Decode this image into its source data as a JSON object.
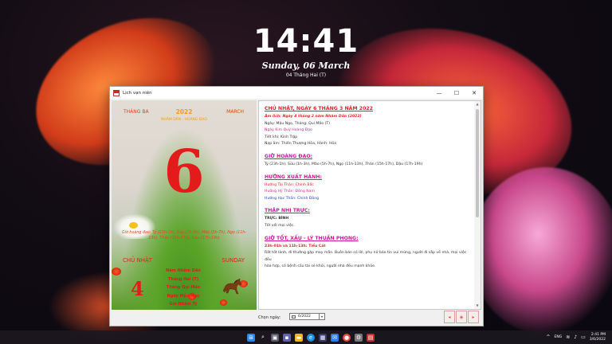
{
  "lockscreen": {
    "time": "14:41",
    "date": "Sunday, 06 March",
    "lunar": "04 Tháng Hai (T)"
  },
  "window": {
    "title": "Lịch vạn niên",
    "controls": {
      "minimize": "—",
      "maximize": "☐",
      "close": "✕"
    }
  },
  "left": {
    "month_vi": "THÁNG BA",
    "year": "2022",
    "month_en": "MARCH",
    "year_canchi": "NHÂM DẦN - HOÀNG ĐẠO",
    "day": "6",
    "hours": "Giờ hoàng đạo: Tý (23h-1h), Sửu (1h-3h), Mão (5h-7h), Ngọ (11h-13h), Thân (15h-17h), Dậu (17h-19h)",
    "dow_vi": "CHỦ NHẬT",
    "dow_en": "SUNDAY",
    "lunar_day": "4",
    "lunar_info": [
      "Năm Nhâm Dần",
      "Tháng Hai (T)",
      "Tháng Quí Mão",
      "Ngày Mậu Ngọ",
      "Giờ Nhâm Tý"
    ]
  },
  "right": {
    "heading": "CHỦ NHẬT, NGÀY 6 THÁNG 3 NĂM 2022",
    "lunar_line": "Âm lịch: Ngày 4 tháng 2 năm Nhâm Dần (2022)",
    "day_line": "Ngày: Mậu Ngọ, Tháng: Quí Mão (T)",
    "hoang_dao_day": "Ngày Kim Quỹ Hoàng Đạo",
    "tiet_khi": "Tiết khí: Kinh Trập",
    "nap_am": "Nạp âm: Thiên Thượng Hỏa, Hành: Hỏa",
    "good_hours_title": "GIỜ HOÀNG ĐẠO:",
    "good_hours": "Tý (23h-1h), Sửu (1h-3h), Mão (5h-7h), Ngọ (11h-13h), Thân (15h-17h), Dậu (17h-19h)",
    "direction_title": "HƯỚNG XUẤT HÀNH:",
    "direction_1": "Hướng Tài Thần: Chính Bắc",
    "direction_2": "Hướng Hỷ Thần: Đông Nam",
    "direction_3": "Hướng Hạc Thần: Chính Đông",
    "truc_title": "THẬP NHỊ TRỰC:",
    "truc_value": "TRỰC: BÌNH",
    "truc_desc": "Tốt với mọi việc.",
    "ly_title": "GIỜ TỐT, XẤU - LÝ THUẦN PHONG:",
    "ly_subtitle": "23h-01h và 11h-13h: Tiểu Cát",
    "ly_desc_1": "Rất tốt lành, đi thường gặp may mắn. Buôn bán có lời, phụ nữ báo tin vui mừng, người đi sắp về nhà, mọi việc đều",
    "ly_desc_2": "hòa hợp, có bệnh cầu tài sẽ khỏi, người nhà đều mạnh khỏe."
  },
  "bottom": {
    "choose_label": "Chọn ngày:",
    "date_value": "6/2022",
    "dropdown": "▾",
    "nav": [
      "◂",
      "◈",
      "▸"
    ]
  },
  "taskbar": {
    "lang": "ENG",
    "time": "2:41 PM",
    "date": "3/6/2022"
  }
}
